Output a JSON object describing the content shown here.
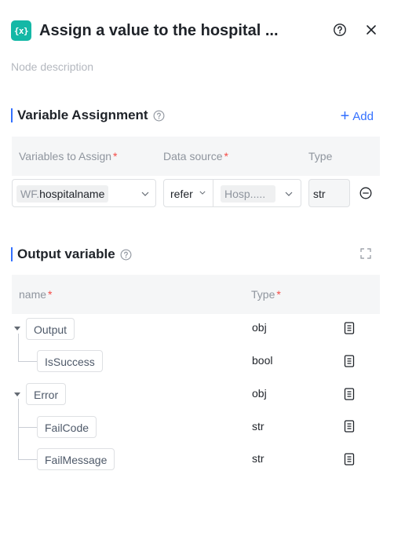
{
  "header": {
    "icon_text": "{x}",
    "title": "Assign a value to the hospital ...",
    "help_icon": "help-circle-icon",
    "close_icon": "close-icon"
  },
  "description_placeholder": "Node description",
  "variable_assignment": {
    "title": "Variable Assignment",
    "add_label": "Add",
    "columns": {
      "variables": "Variables to Assign",
      "source": "Data source",
      "type": "Type"
    },
    "row": {
      "variable_prefix": "WF.",
      "variable_name": "hospitalname",
      "source_mode": "refer",
      "source_value": "Hosp.....",
      "type": "str"
    }
  },
  "output_variable": {
    "title": "Output variable",
    "columns": {
      "name": "name",
      "type": "Type"
    },
    "rows": [
      {
        "name": "Output",
        "type": "obj"
      },
      {
        "name": "IsSuccess",
        "type": "bool"
      },
      {
        "name": "Error",
        "type": "obj"
      },
      {
        "name": "FailCode",
        "type": "str"
      },
      {
        "name": "FailMessage",
        "type": "str"
      }
    ]
  },
  "colors": {
    "accent": "#3370ff",
    "node_icon": "#14b8a6",
    "required": "#f54a45"
  }
}
